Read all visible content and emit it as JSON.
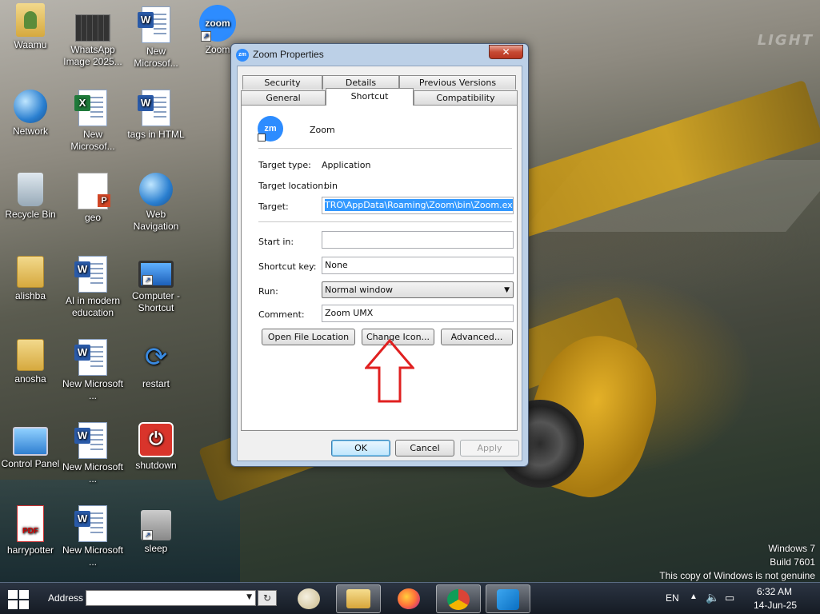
{
  "desktop": {
    "icons": [
      {
        "label": "Waamu"
      },
      {
        "label": "WhatsApp Image 2025..."
      },
      {
        "label": "New Microsof..."
      },
      {
        "label": "Zoom",
        "glyph": "zoom"
      },
      {
        "label": "Network"
      },
      {
        "label": "New Microsof..."
      },
      {
        "label": "tags in HTML"
      },
      {
        "label": "Recycle Bin"
      },
      {
        "label": "geo"
      },
      {
        "label": "Web Navigation"
      },
      {
        "label": "alishba"
      },
      {
        "label": "AI in modern education"
      },
      {
        "label": "Computer - Shortcut"
      },
      {
        "label": "anosha"
      },
      {
        "label": "New Microsoft ..."
      },
      {
        "label": "restart"
      },
      {
        "label": "Control Panel"
      },
      {
        "label": "New Microsoft ..."
      },
      {
        "label": "shutdown"
      },
      {
        "label": "harrypotter",
        "glyph": "PDF"
      },
      {
        "label": "New Microsoft ..."
      },
      {
        "label": "sleep"
      }
    ],
    "badges": {
      "word": "W",
      "excel": "X",
      "ppt": "P"
    },
    "watermark": "LIGHT",
    "windows_notice": {
      "line1": "Windows 7",
      "line2": "Build 7601",
      "line3": "This copy of Windows is not genuine"
    }
  },
  "dialog": {
    "title": "Zoom Properties",
    "title_icon": "zm",
    "close_glyph": "✕",
    "tabs_top": [
      "Security",
      "Details",
      "Previous Versions"
    ],
    "tabs_bottom": [
      "General",
      "Shortcut",
      "Compatibility"
    ],
    "active_tab": "Shortcut",
    "app_icon_glyph": "zm",
    "app_name": "Zoom",
    "target_type_label": "Target type:",
    "target_type_value": "Application",
    "target_location_label": "Target location:",
    "target_location_value": "bin",
    "target_label": "Target:",
    "target_value": "TRO\\AppData\\Roaming\\Zoom\\bin\\Zoom.exe",
    "start_in_label": "Start in:",
    "start_in_value": "",
    "shortcut_key_label": "Shortcut key:",
    "shortcut_key_value": "None",
    "run_label": "Run:",
    "run_value": "Normal window",
    "comment_label": "Comment:",
    "comment_value": "Zoom UMX",
    "open_file_location": "Open File Location",
    "change_icon": "Change Icon...",
    "advanced": "Advanced...",
    "ok": "OK",
    "cancel": "Cancel",
    "apply": "Apply"
  },
  "annotation": {
    "color": "#e02020",
    "icon": "arrow-up-outline"
  },
  "taskbar": {
    "address_label": "Address",
    "address_value": "",
    "apps": [
      "paint",
      "file-explorer",
      "firefox",
      "chrome",
      "vscode"
    ],
    "lang": "EN",
    "time": "6:32 AM",
    "date": "14-Jun-25"
  }
}
